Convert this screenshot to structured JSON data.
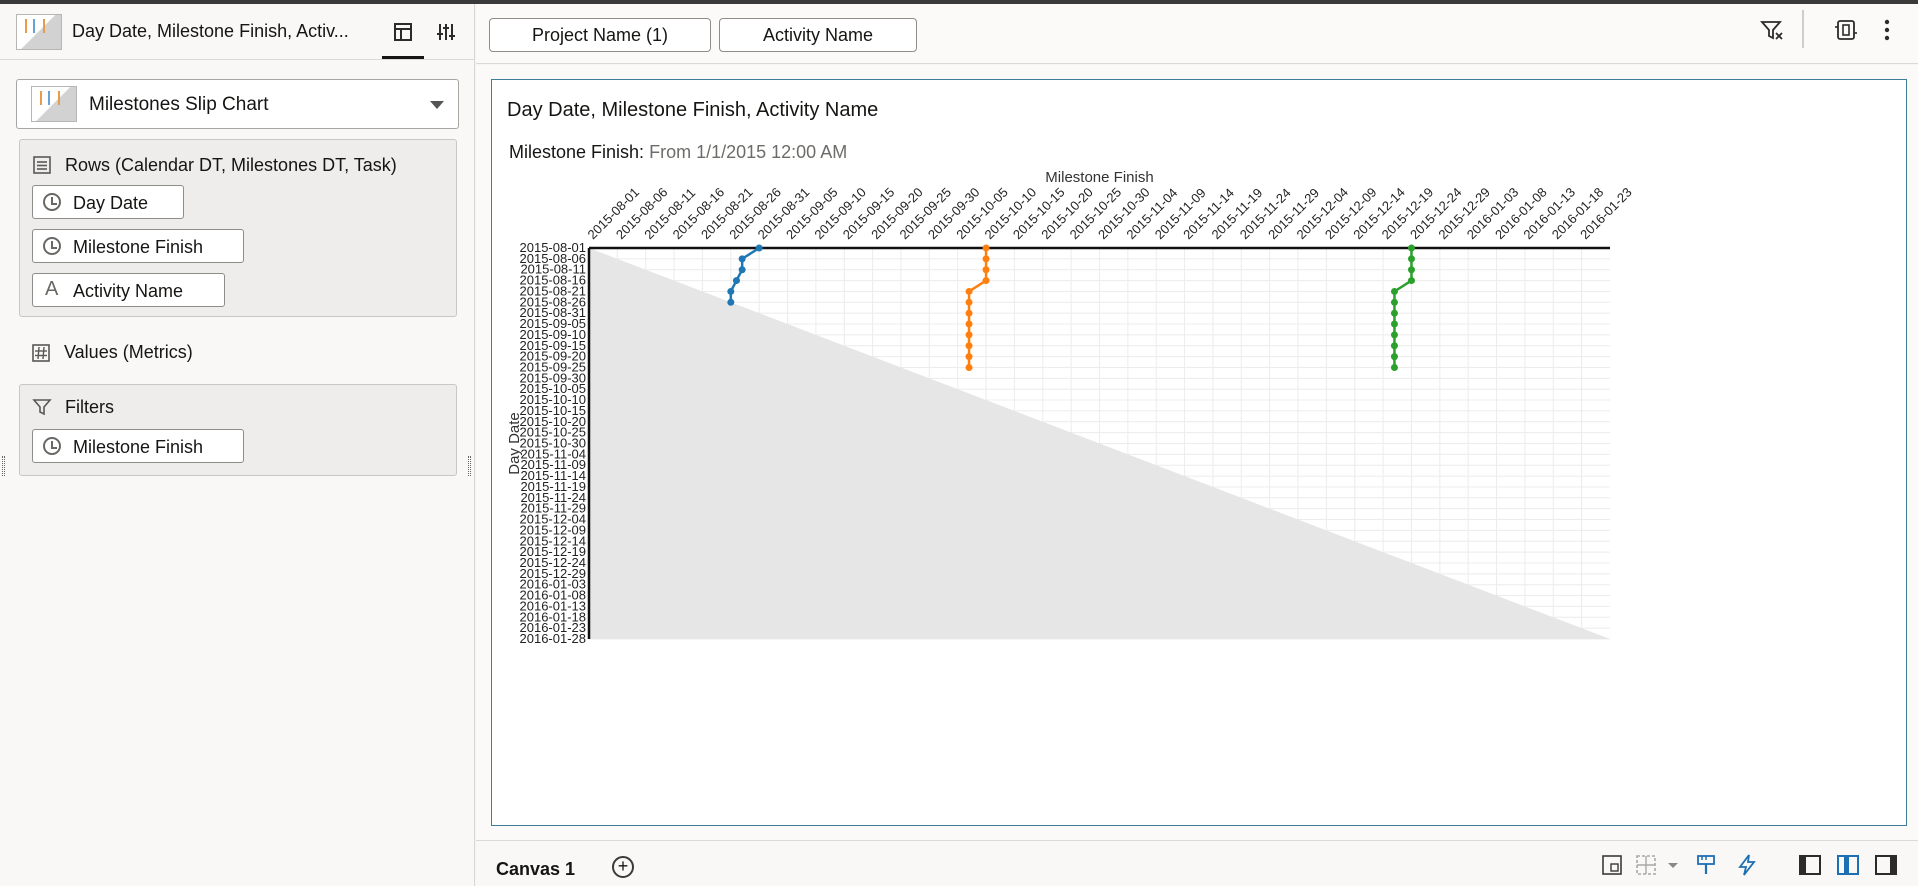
{
  "left_panel": {
    "title": "Day Date, Milestone Finish, Activ...",
    "viz_type": "Milestones Slip Chart",
    "rows_section": {
      "title": "Rows (Calendar DT, Milestones DT, Task)",
      "items": [
        "Day Date",
        "Milestone Finish",
        "Activity Name"
      ]
    },
    "values_section": {
      "title": "Values (Metrics)"
    },
    "filters_section": {
      "title": "Filters",
      "items": [
        "Milestone Finish"
      ]
    }
  },
  "toolbar": {
    "chips": [
      "Project Name (1)",
      "Activity Name"
    ]
  },
  "viz": {
    "title": "Day Date, Milestone Finish, Activity Name",
    "filter_label": "Milestone Finish:",
    "filter_value": "From 1/1/2015 12:00 AM"
  },
  "chart_data": {
    "type": "line",
    "subtype": "milestone-slip",
    "xlabel": "Milestone Finish",
    "ylabel": "Day Date",
    "x_ticks": [
      "2015-08-01",
      "2015-08-06",
      "2015-08-11",
      "2015-08-16",
      "2015-08-21",
      "2015-08-26",
      "2015-08-31",
      "2015-09-05",
      "2015-09-10",
      "2015-09-15",
      "2015-09-20",
      "2015-09-25",
      "2015-09-30",
      "2015-10-05",
      "2015-10-10",
      "2015-10-15",
      "2015-10-20",
      "2015-10-25",
      "2015-10-30",
      "2015-11-04",
      "2015-11-09",
      "2015-11-14",
      "2015-11-19",
      "2015-11-24",
      "2015-11-29",
      "2015-12-04",
      "2015-12-09",
      "2015-12-14",
      "2015-12-19",
      "2015-12-24",
      "2015-12-29",
      "2016-01-03",
      "2016-01-08",
      "2016-01-13",
      "2016-01-18",
      "2016-01-23"
    ],
    "y_ticks": [
      "2015-08-01",
      "2015-08-06",
      "2015-08-11",
      "2015-08-16",
      "2015-08-21",
      "2015-08-26",
      "2015-08-31",
      "2015-09-05",
      "2015-09-10",
      "2015-09-15",
      "2015-09-20",
      "2015-09-25",
      "2015-09-30",
      "2015-10-05",
      "2015-10-10",
      "2015-10-15",
      "2015-10-20",
      "2015-10-25",
      "2015-10-30",
      "2015-11-04",
      "2015-11-09",
      "2015-11-14",
      "2015-11-19",
      "2015-11-24",
      "2015-11-29",
      "2015-12-04",
      "2015-12-09",
      "2015-12-14",
      "2015-12-19",
      "2015-12-24",
      "2015-12-29",
      "2016-01-03",
      "2016-01-08",
      "2016-01-13",
      "2016-01-18",
      "2016-01-23",
      "2016-01-28"
    ],
    "xlim": [
      "2015-08-01",
      "2016-01-28"
    ],
    "ylim": [
      "2015-08-01",
      "2016-01-28"
    ],
    "series": [
      {
        "color": "#1f77b4",
        "points": [
          [
            "2015-08-31",
            "2015-08-01"
          ],
          [
            "2015-08-28",
            "2015-08-06"
          ],
          [
            "2015-08-28",
            "2015-08-11"
          ],
          [
            "2015-08-27",
            "2015-08-16"
          ],
          [
            "2015-08-26",
            "2015-08-21"
          ],
          [
            "2015-08-26",
            "2015-08-26"
          ]
        ]
      },
      {
        "color": "#ff7f0e",
        "points": [
          [
            "2015-10-10",
            "2015-08-01"
          ],
          [
            "2015-10-10",
            "2015-08-06"
          ],
          [
            "2015-10-10",
            "2015-08-11"
          ],
          [
            "2015-10-10",
            "2015-08-16"
          ],
          [
            "2015-10-07",
            "2015-08-21"
          ],
          [
            "2015-10-07",
            "2015-08-26"
          ],
          [
            "2015-10-07",
            "2015-08-31"
          ],
          [
            "2015-10-07",
            "2015-09-05"
          ],
          [
            "2015-10-07",
            "2015-09-10"
          ],
          [
            "2015-10-07",
            "2015-09-15"
          ],
          [
            "2015-10-07",
            "2015-09-20"
          ],
          [
            "2015-10-07",
            "2015-09-25"
          ]
        ]
      },
      {
        "color": "#2ca02c",
        "points": [
          [
            "2015-12-24",
            "2015-08-01"
          ],
          [
            "2015-12-24",
            "2015-08-06"
          ],
          [
            "2015-12-24",
            "2015-08-11"
          ],
          [
            "2015-12-24",
            "2015-08-16"
          ],
          [
            "2015-12-21",
            "2015-08-21"
          ],
          [
            "2015-12-21",
            "2015-08-26"
          ],
          [
            "2015-12-21",
            "2015-08-31"
          ],
          [
            "2015-12-21",
            "2015-09-05"
          ],
          [
            "2015-12-21",
            "2015-09-10"
          ],
          [
            "2015-12-21",
            "2015-09-15"
          ],
          [
            "2015-12-21",
            "2015-09-20"
          ],
          [
            "2015-12-21",
            "2015-09-25"
          ]
        ]
      }
    ]
  },
  "bottom_bar": {
    "canvas_tab": "Canvas 1",
    "add_symbol": "+"
  },
  "icons": {
    "header_icons": [
      "visualize-grammar-icon",
      "properties-icon"
    ],
    "toolbar_icons": [
      "filter-clear-icon",
      "present-icon",
      "more-options-icon"
    ],
    "bottom_icons": [
      "canvas-properties-icon",
      "layout-icon",
      "format-brush-icon",
      "auto-insights-icon",
      "left-panel-toggle-icon",
      "middle-panel-toggle-icon",
      "right-panel-toggle-icon"
    ]
  }
}
